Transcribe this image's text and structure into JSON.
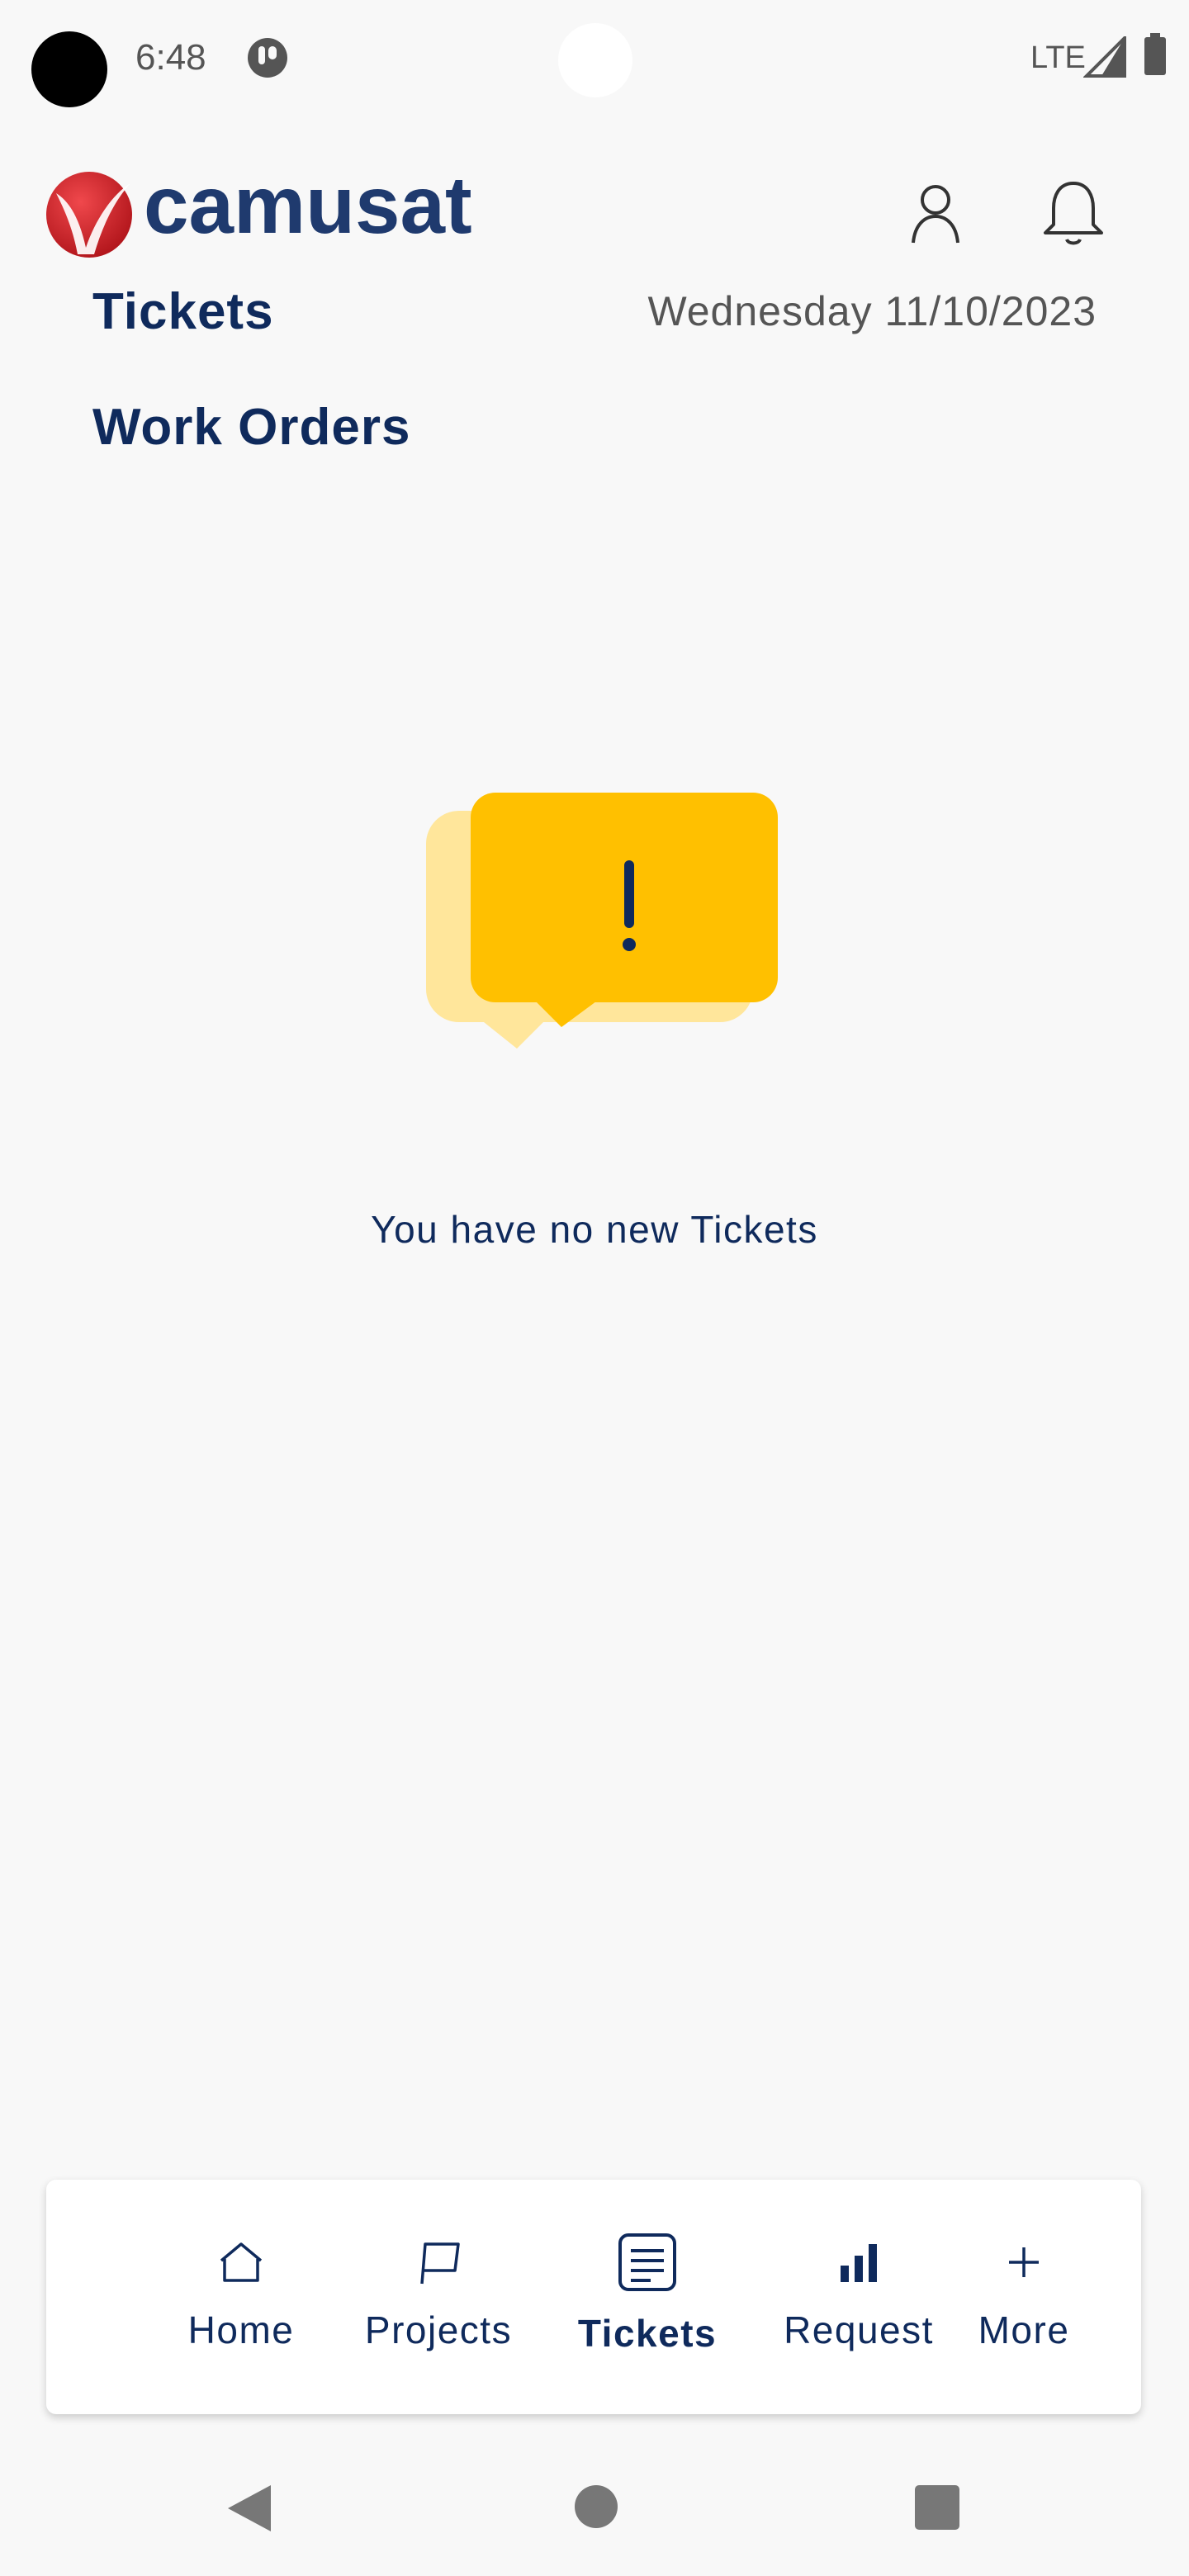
{
  "status_bar": {
    "time": "6:48",
    "network": "LTE"
  },
  "header": {
    "logo_text": "camusat",
    "tabs": [
      {
        "label": "Tickets"
      },
      {
        "label": "Work Orders"
      }
    ],
    "date": "Wednesday 11/10/2023"
  },
  "empty_state": {
    "icon": "exclamation-speech-bubbles-icon",
    "message": "You have no new Tickets"
  },
  "bottom_nav": {
    "items": [
      {
        "label": "Home",
        "icon": "home-icon"
      },
      {
        "label": "Projects",
        "icon": "flag-icon"
      },
      {
        "label": "Tickets",
        "icon": "tickets-list-icon",
        "active": true
      },
      {
        "label": "Request",
        "icon": "bar-chart-icon"
      },
      {
        "label": "More",
        "icon": "plus-icon"
      }
    ]
  },
  "colors": {
    "brand_navy": "#0f2a5c",
    "brand_red": "#d71920",
    "alert_yellow": "#ffc000",
    "alert_yellow_light": "#ffe69b",
    "background": "#f8f8f8"
  }
}
